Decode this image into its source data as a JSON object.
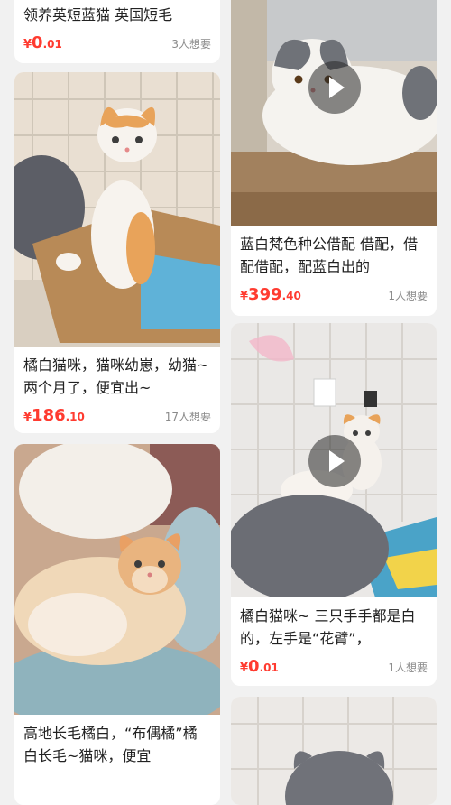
{
  "listings": [
    {
      "title": "领养英短蓝猫 英国短毛",
      "currency": "¥",
      "price_int": "0",
      "price_dec": ".01",
      "wants": "3人想要"
    },
    {
      "title": "橘白猫咪，猫咪幼崽，幼猫~ 两个月了，便宜出~",
      "currency": "¥",
      "price_int": "186",
      "price_dec": ".10",
      "wants": "17人想要"
    },
    {
      "title": "高地长毛橘白，“布偶橘”橘白长毛~猫咪，便宜",
      "currency": "¥",
      "price_int": "",
      "price_dec": "",
      "wants": ""
    },
    {
      "title": "蓝白梵色种公借配 借配，借配借配，配蓝白出的",
      "currency": "¥",
      "price_int": "399",
      "price_dec": ".40",
      "wants": "1人想要"
    },
    {
      "title": "橘白猫咪~ 三只手手都是白的，左手是“花臂”，",
      "currency": "¥",
      "price_int": "0",
      "price_dec": ".01",
      "wants": "1人想要"
    }
  ],
  "icons": {
    "play": "play-icon"
  },
  "colors": {
    "price": "#ff3b30",
    "badge": "#ffd43b",
    "background": "#f1f1f1"
  }
}
